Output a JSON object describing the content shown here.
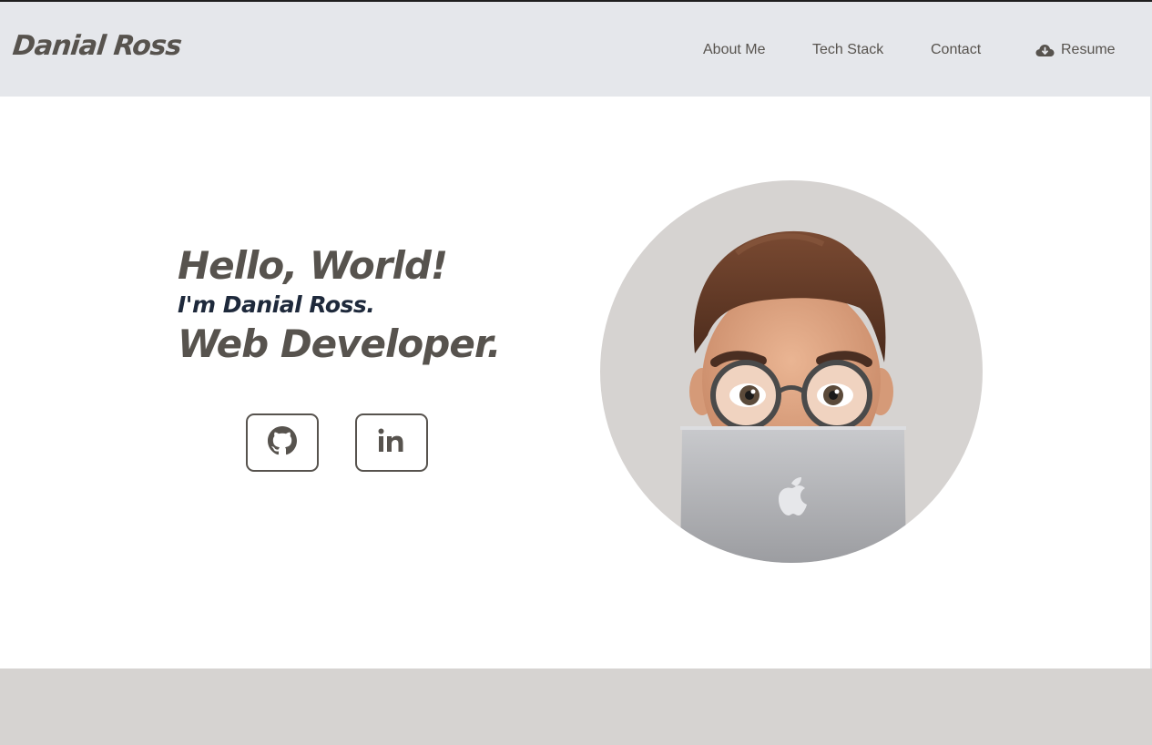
{
  "header": {
    "brand": "Danial Ross",
    "nav": {
      "about": "About Me",
      "tech": "Tech Stack",
      "contact": "Contact",
      "resume": "Resume"
    },
    "resume_icon": "cloud-download-icon"
  },
  "hero": {
    "greeting": "Hello, World!",
    "name_line": "I'm Danial Ross.",
    "role": "Web Developer.",
    "social": [
      {
        "icon": "github-icon"
      },
      {
        "icon": "linkedin-icon"
      }
    ],
    "avatar": "memoji-avatar"
  },
  "colors": {
    "nav_bg": "#e5e7eb",
    "text_primary": "#57534e",
    "text_accent": "#1e293b",
    "avatar_bg": "#d6d3d1",
    "footer_band": "#d6d3d1"
  }
}
